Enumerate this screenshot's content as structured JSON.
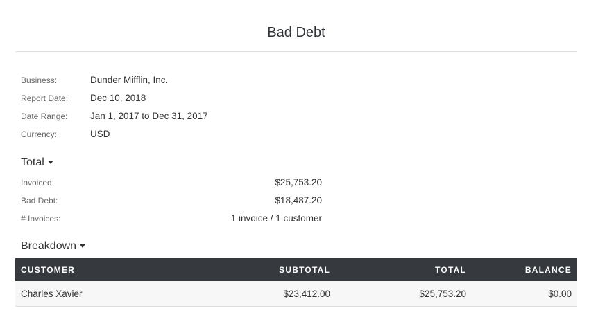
{
  "title": "Bad Debt",
  "info": [
    {
      "label": "Business:",
      "value": "Dunder Mifflin, Inc."
    },
    {
      "label": "Report Date:",
      "value": "Dec 10, 2018"
    },
    {
      "label": "Date Range:",
      "value": "Jan 1, 2017 to Dec 31, 2017"
    },
    {
      "label": "Currency:",
      "value": "USD"
    }
  ],
  "total": {
    "heading": "Total",
    "rows": [
      {
        "label": "Invoiced:",
        "value": "$25,753.20"
      },
      {
        "label": "Bad Debt:",
        "value": "$18,487.20"
      },
      {
        "label": "# Invoices:",
        "value": "1 invoice / 1 customer"
      }
    ]
  },
  "breakdown": {
    "heading": "Breakdown",
    "columns": [
      "CUSTOMER",
      "SUBTOTAL",
      "TOTAL",
      "BALANCE"
    ],
    "rows": [
      [
        "Charles Xavier",
        "$23,412.00",
        "$25,753.20",
        "$0.00"
      ]
    ]
  }
}
